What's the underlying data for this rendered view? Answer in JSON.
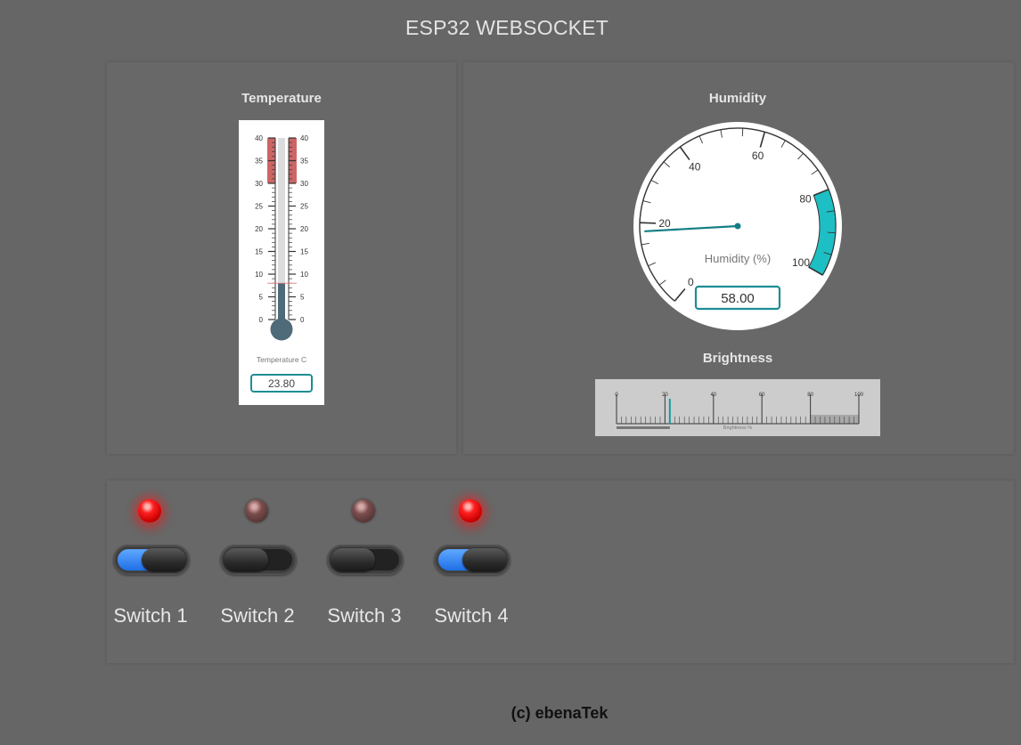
{
  "header": {
    "title": "ESP32 WEBSOCKET"
  },
  "temperature": {
    "panel_title": "Temperature",
    "label": "Temperature C",
    "value": "23.80",
    "scale_ticks": [
      "0",
      "5",
      "10",
      "15",
      "20",
      "25",
      "30",
      "35",
      "40"
    ],
    "min": 0,
    "max": 40,
    "fill_level": 8,
    "highlight_from": 30,
    "colors": {
      "mercury": "#4f6a78",
      "highlight": "#cc6666",
      "value_border": "#1d8e94"
    }
  },
  "humidity": {
    "panel_title": "Humidity",
    "label": "Humidity (%)",
    "value": "58.00",
    "needle_value": 18,
    "scale_ticks": [
      "0",
      "20",
      "40",
      "60",
      "80",
      "100"
    ],
    "highlight_from": 80,
    "colors": {
      "highlight": "#1ebfc4",
      "needle": "#147e85",
      "value_border": "#1d8e94"
    }
  },
  "brightness": {
    "panel_title": "Brightness",
    "label": "Brightness %",
    "scale_ticks": [
      "0",
      "20",
      "40",
      "60",
      "80",
      "100"
    ],
    "marker_value": 22,
    "colors": {
      "marker": "#1a9aa0"
    }
  },
  "switches": [
    {
      "label": "Switch 1",
      "state": "on"
    },
    {
      "label": "Switch 2",
      "state": "off"
    },
    {
      "label": "Switch 3",
      "state": "off"
    },
    {
      "label": "Switch 4",
      "state": "on"
    }
  ],
  "footer": {
    "text": "(c) ebenaTek"
  }
}
